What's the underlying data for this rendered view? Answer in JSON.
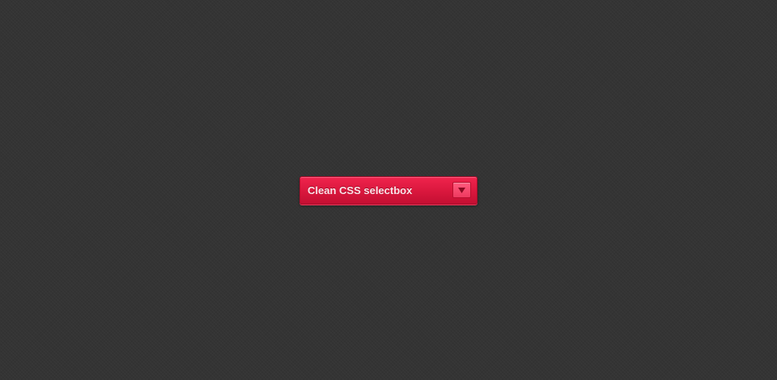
{
  "selectbox": {
    "selected_label": "Clean CSS selectbox",
    "arrow_icon": "chevron-down-icon"
  },
  "colors": {
    "background": "#343434",
    "select_accent": "#d9173d",
    "label_text": "#fbe3e8",
    "arrow_glyph": "#8a0a22"
  }
}
